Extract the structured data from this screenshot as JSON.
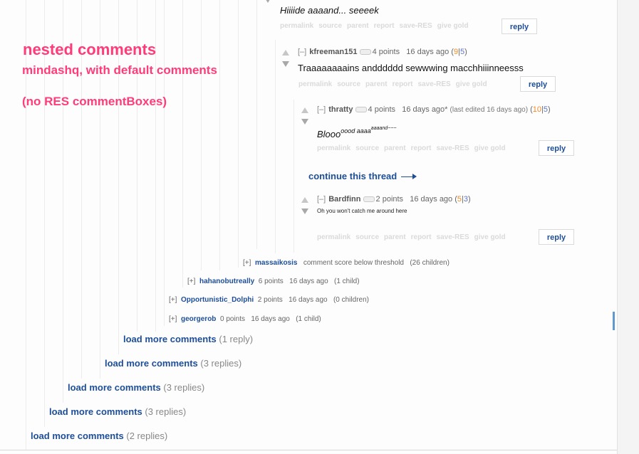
{
  "annotations": {
    "title": "nested comments",
    "line1": "mindashq, with default comments",
    "line2": "(no RES commentBoxes)"
  },
  "action_buttons": [
    "permalink",
    "source",
    "parent",
    "report",
    "save-RES",
    "give gold"
  ],
  "reply_label": "reply",
  "top_comment": {
    "text": "Hiiiide aaaand... seeeek"
  },
  "comment_kfreeman": {
    "toggle": "[–]",
    "author": "kfreeman151",
    "points": "4 points",
    "age": "16 days ago",
    "votes_open": "(",
    "ups": "9",
    "sep": "|",
    "downs": "5",
    "votes_close": ")",
    "text": "Traaaaaaaains andddddd sewwwing macchhiiinneesss"
  },
  "comment_thratty": {
    "toggle": "[–]",
    "author": "thratty",
    "points": "4 points",
    "age": "16 days ago*",
    "edited": "(last edited 16 days ago)",
    "votes_open": "(",
    "ups": "10",
    "sep": "|",
    "downs": "5",
    "votes_close": ")",
    "text_main": "Blooo",
    "text_sup1": "oood aaaa",
    "text_sup2": "aaaand~~~"
  },
  "continue_thread": "continue this thread",
  "comment_bardfinn": {
    "toggle": "[–]",
    "author": "Bardfinn",
    "points": "2 points",
    "age": "16 days ago",
    "votes_open": "(",
    "ups": "5",
    "sep": "|",
    "downs": "3",
    "votes_close": ")",
    "text": "Oh you won't catch me around here"
  },
  "collapsed": [
    {
      "toggle": "[+]",
      "author": "massaikosis",
      "info": "comment score below threshold",
      "children": "(26 children)"
    },
    {
      "toggle": "[+]",
      "author": "hahanobutreally",
      "info": "6 points   16 days ago",
      "children": "(1 child)"
    },
    {
      "toggle": "[+]",
      "author": "Opportunistic_Dolphi",
      "info": "2 points   16 days ago",
      "children": "(0 children)"
    },
    {
      "toggle": "[+]",
      "author": "georgerob",
      "info": "0 points   16 days ago",
      "children": "(1 child)"
    }
  ],
  "load_more": [
    {
      "link": "load more comments",
      "count": "(1 reply)"
    },
    {
      "link": "load more comments",
      "count": "(3 replies)"
    },
    {
      "link": "load more comments",
      "count": "(3 replies)"
    },
    {
      "link": "load more comments",
      "count": "(3 replies)"
    },
    {
      "link": "load more comments",
      "count": "(2 replies)"
    }
  ]
}
